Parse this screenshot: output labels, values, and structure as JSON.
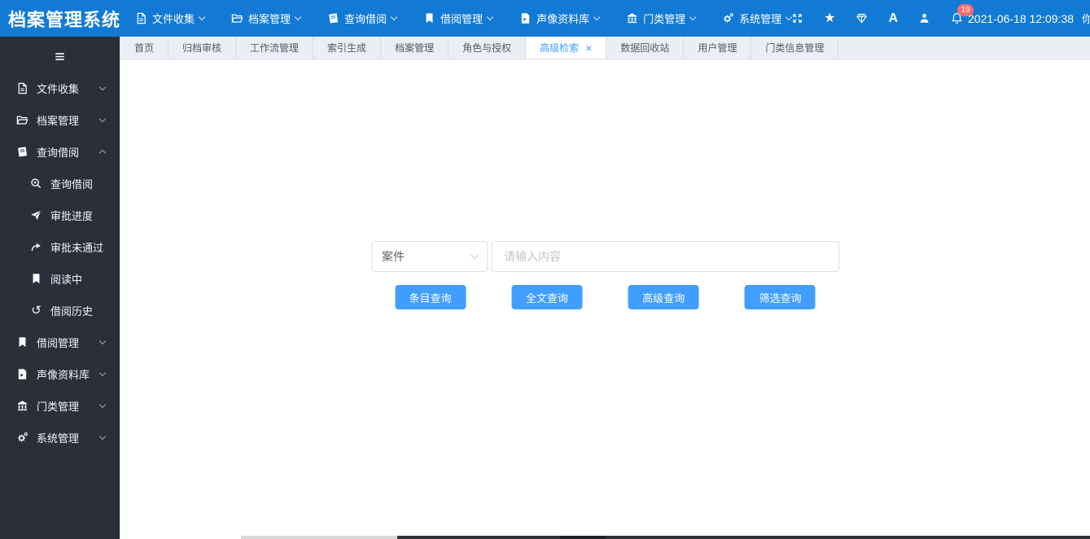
{
  "app_title": "档案管理系统",
  "header": {
    "nav": [
      {
        "label": "文件收集",
        "icon": "file-icon"
      },
      {
        "label": "档案管理",
        "icon": "folder-open-icon"
      },
      {
        "label": "查询借阅",
        "icon": "book-icon"
      },
      {
        "label": "借阅管理",
        "icon": "bookmark-icon"
      },
      {
        "label": "声像资料库",
        "icon": "media-file-icon"
      },
      {
        "label": "门类管理",
        "icon": "bank-icon"
      },
      {
        "label": "系统管理",
        "icon": "gears-icon"
      }
    ],
    "utility_icons": [
      "fullscreen-icon",
      "star-icon",
      "gem-icon",
      "font-size-icon",
      "user-icon",
      "bell-icon"
    ],
    "font_size_icon_label": "A",
    "star_icon_glyph": "★",
    "notification_count": "19",
    "datetime": "2021-06-18 12:09:38",
    "greeting": "你好 管理员"
  },
  "sidebar": {
    "collapse_icon": "hamburger-icon",
    "items": [
      {
        "label": "文件收集",
        "icon": "file-icon",
        "state": "collapsed"
      },
      {
        "label": "档案管理",
        "icon": "folder-open-icon",
        "state": "collapsed"
      },
      {
        "label": "查询借阅",
        "icon": "book-icon",
        "state": "expanded"
      },
      {
        "label": "借阅管理",
        "icon": "bookmark-icon",
        "state": "collapsed"
      },
      {
        "label": "声像资料库",
        "icon": "media-file-icon",
        "state": "collapsed"
      },
      {
        "label": "门类管理",
        "icon": "bank-icon",
        "state": "collapsed"
      },
      {
        "label": "系统管理",
        "icon": "gears-icon",
        "state": "collapsed"
      }
    ],
    "submenu": [
      {
        "label": "查询借阅",
        "icon": "search-plus-icon"
      },
      {
        "label": "审批进度",
        "icon": "send-icon"
      },
      {
        "label": "审批未通过",
        "icon": "redo-arrow-icon"
      },
      {
        "label": "阅读中",
        "icon": "bookmark-icon"
      },
      {
        "label": "借阅历史",
        "icon": "history-icon",
        "glyph": "↺"
      }
    ]
  },
  "tabs": [
    {
      "label": "首页"
    },
    {
      "label": "归档审核"
    },
    {
      "label": "工作流管理"
    },
    {
      "label": "索引生成"
    },
    {
      "label": "档案管理"
    },
    {
      "label": "角色与授权"
    },
    {
      "label": "高级检索",
      "active": true,
      "close_label": "×"
    },
    {
      "label": "数据回收站"
    },
    {
      "label": "用户管理"
    },
    {
      "label": "门类信息管理"
    }
  ],
  "search": {
    "category_value": "案件",
    "input_placeholder": "请输入内容",
    "input_value": "",
    "buttons": [
      {
        "label": "条目查询"
      },
      {
        "label": "全文查询"
      },
      {
        "label": "高级查询"
      },
      {
        "label": "筛选查询"
      }
    ]
  },
  "colors": {
    "header_bg": "#127ad5",
    "sidebar_bg": "#2b2f3a",
    "accent": "#409eff",
    "badge_bg": "#f56c6c",
    "tabbar_bg": "#ebeef3"
  }
}
